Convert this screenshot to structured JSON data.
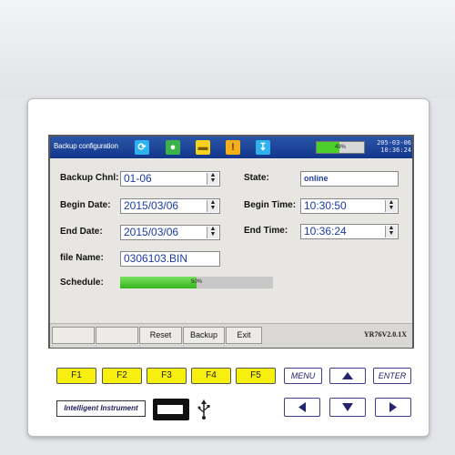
{
  "window": {
    "title": "Backup configuration",
    "battery_label": "49%",
    "battery_level": 0.49,
    "date": "205-03-06",
    "time": "10:36:24"
  },
  "titlebar_icons": [
    "refresh-icon",
    "person-icon",
    "folder-icon",
    "alert-icon",
    "download-icon"
  ],
  "form": {
    "backup_chnl_label": "Backup Chnl:",
    "backup_chnl_value": "01-06",
    "begin_date_label": "Begin Date:",
    "begin_date_value": "2015/03/06",
    "end_date_label": "End Date:",
    "end_date_value": "2015/03/06",
    "file_name_label": "file Name:",
    "file_name_value": "0306103.BIN",
    "schedule_label": "Schedule:",
    "schedule_progress": 0.5,
    "schedule_text": "50%",
    "state_label": "State:",
    "state_value": "online",
    "begin_time_label": "Begin Time:",
    "begin_time_value": "10:30:50",
    "end_time_label": "End Time:",
    "end_time_value": "10:36:24"
  },
  "bottom_bar": {
    "buttons": [
      "",
      "",
      "Reset",
      "Backup",
      "Exit"
    ],
    "version": "YR76V2.0.1X"
  },
  "keypad": {
    "function_keys": [
      "F1",
      "F2",
      "F3",
      "F4",
      "F5"
    ],
    "menu": "MENU",
    "enter": "ENTER",
    "brand": "Intelligent Instrument"
  },
  "colors": {
    "titlebar": "#1d45a0",
    "field_text": "#1a3aa7",
    "function_key": "#f7f00f",
    "progress": "#3fbf24"
  }
}
